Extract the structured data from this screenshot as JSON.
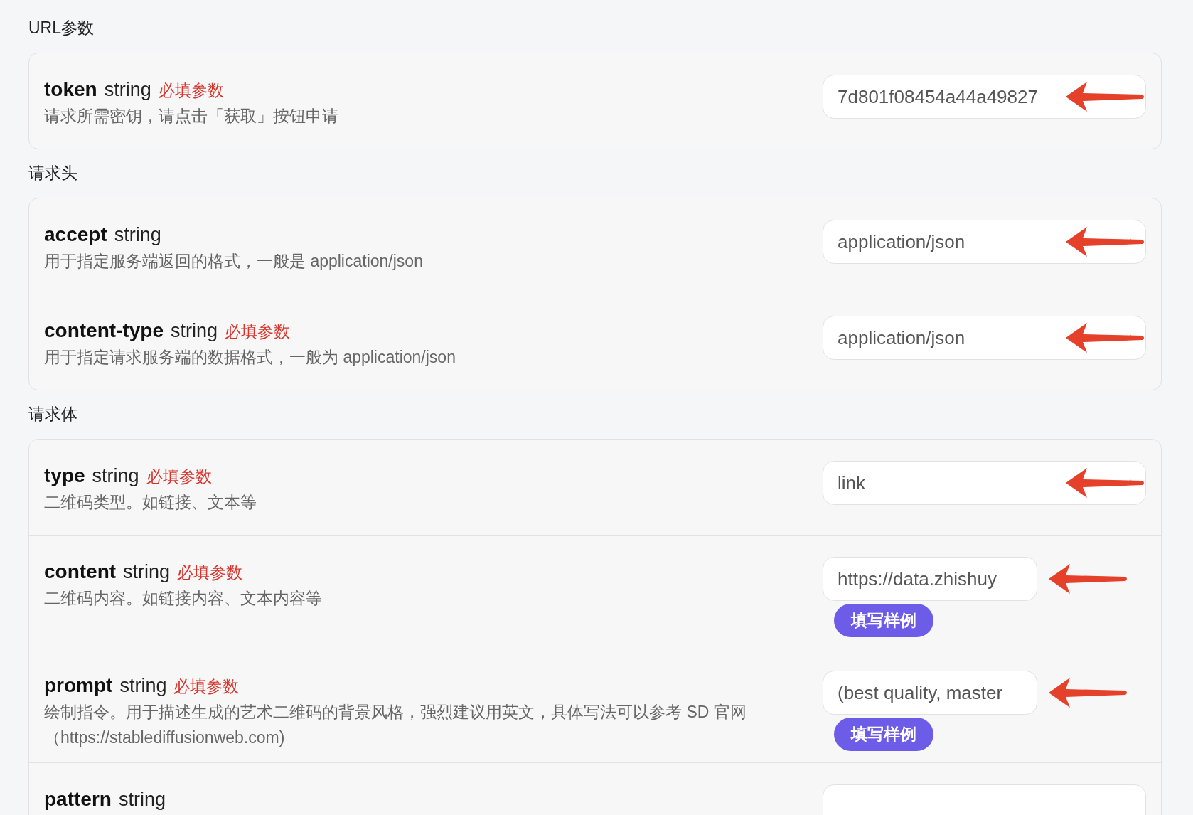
{
  "sections": [
    {
      "title": "URL参数",
      "rows": [
        {
          "name": "token",
          "type": "string",
          "required_label": "必填参数",
          "description": "请求所需密钥，请点击「获取」按钮申请",
          "field": {
            "kind": "input",
            "value": "7d801f08454a44a49827"
          },
          "arrow": true
        }
      ]
    },
    {
      "title": "请求头",
      "rows": [
        {
          "name": "accept",
          "type": "string",
          "description": "用于指定服务端返回的格式，一般是 application/json",
          "field": {
            "kind": "select",
            "value": "application/json"
          },
          "arrow": true
        },
        {
          "name": "content-type",
          "type": "string",
          "required_label": "必填参数",
          "description": "用于指定请求服务端的数据格式，一般为 application/json",
          "field": {
            "kind": "select",
            "value": "application/json"
          },
          "arrow": true
        }
      ]
    },
    {
      "title": "请求体",
      "rows": [
        {
          "name": "type",
          "type": "string",
          "required_label": "必填参数",
          "description": "二维码类型。如链接、文本等",
          "field": {
            "kind": "select",
            "value": "link"
          },
          "arrow": true
        },
        {
          "name": "content",
          "type": "string",
          "required_label": "必填参数",
          "description": "二维码内容。如链接内容、文本内容等",
          "field": {
            "kind": "input_short",
            "value": "https://data.zhishuy"
          },
          "sample_button": "填写样例",
          "arrow": true
        },
        {
          "name": "prompt",
          "type": "string",
          "required_label": "必填参数",
          "description": "绘制指令。用于描述生成的艺术二维码的背景风格，强烈建议用英文，具体写法可以参考 SD 官网（https://stablediffusionweb.com)",
          "field": {
            "kind": "input_short",
            "value": "(best quality, master"
          },
          "sample_button": "填写样例",
          "arrow": true
        },
        {
          "name": "pattern",
          "type": "string",
          "field": {
            "kind": "input"
          },
          "arrow": false
        }
      ]
    }
  ]
}
